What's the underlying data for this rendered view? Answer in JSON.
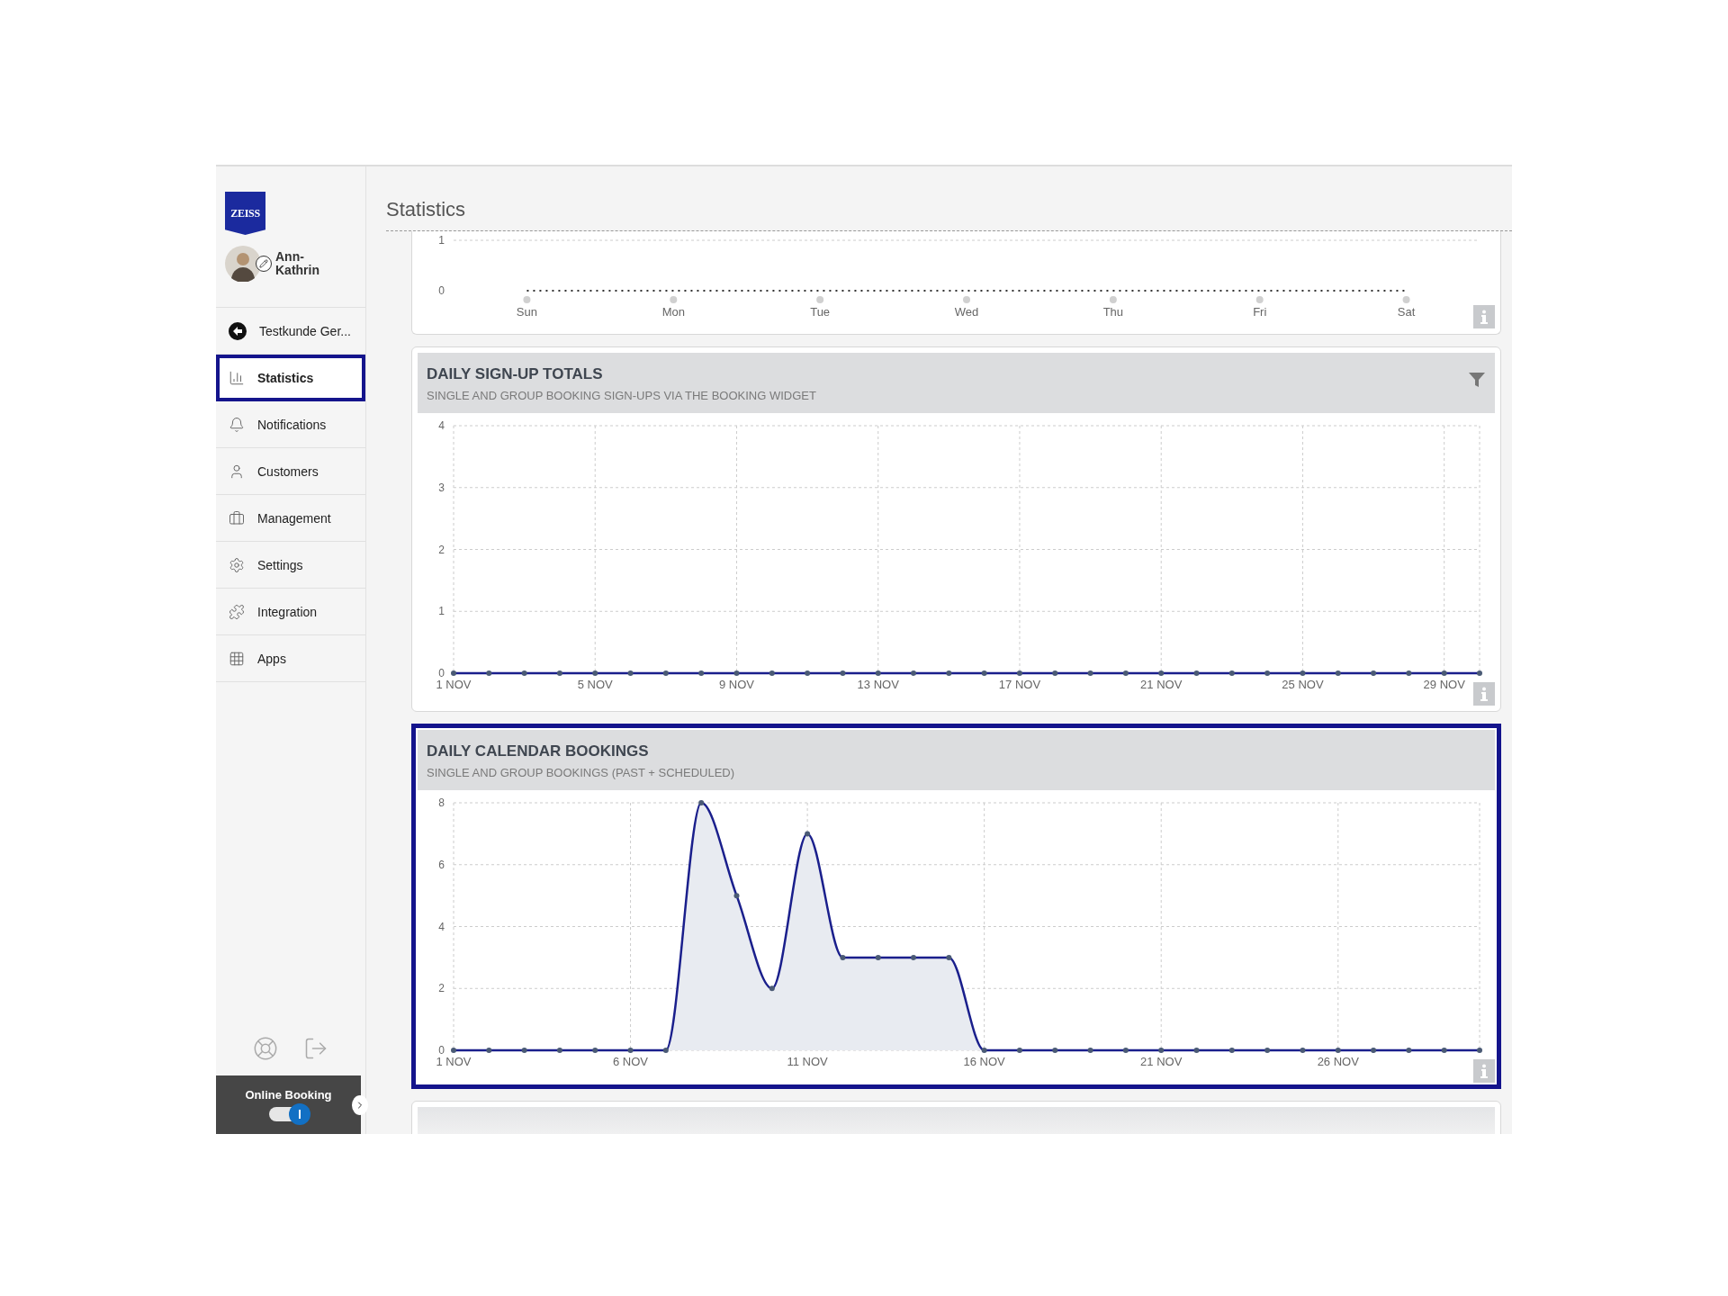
{
  "logo": "ZEISS",
  "user": {
    "name": "Ann-Kathrin"
  },
  "sidebar": {
    "back_link": "Testkunde Ger...",
    "items": [
      {
        "label": "Statistics",
        "selected": true
      },
      {
        "label": "Notifications",
        "selected": false
      },
      {
        "label": "Customers",
        "selected": false
      },
      {
        "label": "Management",
        "selected": false
      },
      {
        "label": "Settings",
        "selected": false
      },
      {
        "label": "Integration",
        "selected": false
      },
      {
        "label": "Apps",
        "selected": false
      }
    ],
    "online_booking": {
      "label": "Online Booking",
      "on": true
    }
  },
  "page_title": "Statistics",
  "cards": [
    {
      "kind": "weekday",
      "highlighted": false,
      "chart_data": {
        "type": "line",
        "categories": [
          "Sun",
          "Mon",
          "Tue",
          "Wed",
          "Thu",
          "Fri",
          "Sat"
        ],
        "yticks": [
          0,
          1
        ],
        "ylim": [
          0,
          1
        ],
        "grid": true,
        "series": [
          {
            "color": "#333333",
            "line_style": "dotted",
            "marker": "none",
            "values": [
              0,
              0,
              0,
              0,
              0,
              0,
              0
            ]
          }
        ]
      }
    },
    {
      "kind": "chart",
      "title": "DAILY SIGN-UP TOTALS",
      "subtitle": "SINGLE AND GROUP BOOKING SIGN-UPS VIA THE BOOKING WIDGET",
      "filter": true,
      "highlighted": false,
      "chart_data": {
        "type": "line",
        "categories": [
          "1 NOV",
          null,
          null,
          null,
          "5 NOV",
          null,
          null,
          null,
          "9 NOV",
          null,
          null,
          null,
          "13 NOV",
          null,
          null,
          null,
          "17 NOV",
          null,
          null,
          null,
          "21 NOV",
          null,
          null,
          null,
          "25 NOV",
          null,
          null,
          null,
          "29 NOV",
          null
        ],
        "yticks": [
          0,
          1,
          2,
          3,
          4
        ],
        "ylim": [
          0,
          4
        ],
        "grid": true,
        "series": [
          {
            "color": "#1a1f8c",
            "marker": "circle",
            "values": [
              0,
              0,
              0,
              0,
              0,
              0,
              0,
              0,
              0,
              0,
              0,
              0,
              0,
              0,
              0,
              0,
              0,
              0,
              0,
              0,
              0,
              0,
              0,
              0,
              0,
              0,
              0,
              0,
              0,
              0
            ]
          }
        ]
      }
    },
    {
      "kind": "chart",
      "title": "DAILY CALENDAR BOOKINGS",
      "subtitle": "SINGLE AND GROUP BOOKINGS (PAST + SCHEDULED)",
      "highlighted": true,
      "chart_data": {
        "type": "area",
        "categories": [
          "1 NOV",
          null,
          null,
          null,
          null,
          "6 NOV",
          null,
          null,
          null,
          null,
          "11 NOV",
          null,
          null,
          null,
          null,
          "16 NOV",
          null,
          null,
          null,
          null,
          "21 NOV",
          null,
          null,
          null,
          null,
          "26 NOV",
          null,
          null,
          null,
          null
        ],
        "yticks": [
          0,
          2,
          4,
          6,
          8
        ],
        "ylim": [
          0,
          8
        ],
        "grid": true,
        "series": [
          {
            "color": "#1a1f8c",
            "marker": "circle",
            "values": [
              0,
              0,
              0,
              0,
              0,
              0,
              0,
              8,
              5,
              2,
              7,
              3,
              3,
              3,
              3,
              0,
              0,
              0,
              0,
              0,
              0,
              0,
              0,
              0,
              0,
              0,
              0,
              0,
              0,
              0
            ]
          }
        ]
      }
    },
    {
      "kind": "faded",
      "highlighted": false
    }
  ]
}
